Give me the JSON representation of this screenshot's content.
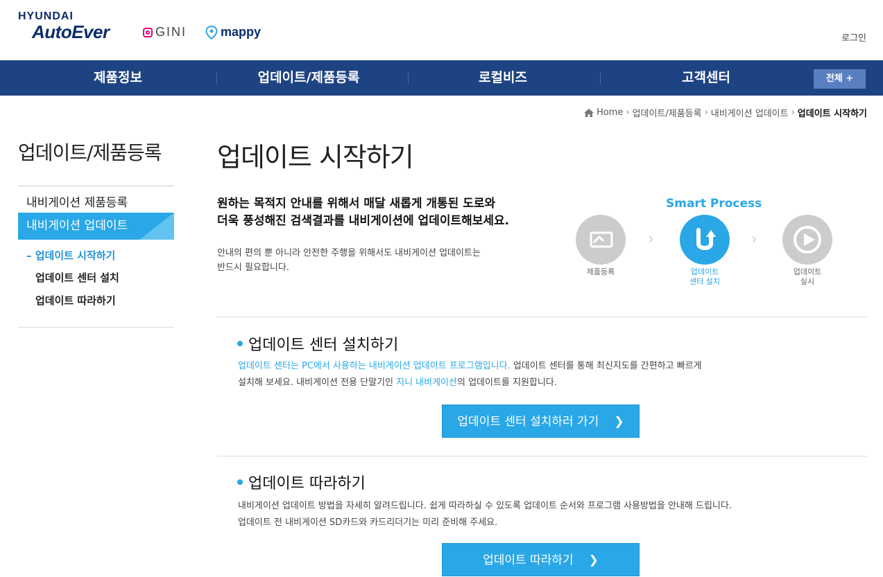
{
  "header": {
    "brand_top": "HYUNDAI",
    "brand_main": "AutoEver",
    "gini": "GINI",
    "mappy": "mappy",
    "login": "로그인"
  },
  "nav": {
    "items": [
      "제품정보",
      "업데이트/제품등록",
      "로컬비즈",
      "고객센터"
    ],
    "all_button": "전체 +"
  },
  "breadcrumb": {
    "home": "Home",
    "level1": "업데이트/제품등록",
    "level2": "내비게이션 업데이트",
    "current": "업데이트 시작하기"
  },
  "sidebar": {
    "title": "업데이트/제품등록",
    "items": [
      "내비게이션 제품등록",
      "내비게이션 업데이트"
    ],
    "subitems": [
      "업데이트 시작하기",
      "업데이트 센터 설치",
      "업데이트 따라하기"
    ]
  },
  "main": {
    "title": "업데이트 시작하기",
    "intro_bold_1": "원하는 목적지 안내를 위해서 매달 새롭게 개통된 도로와",
    "intro_bold_2": "더욱 풍성해진 검색결과를 내비게이션에 업데이트해보세요.",
    "intro_1": "안내의 편의 뿐 아니라 안전한 주행을 위해서도 내비게이션 업데이트는",
    "intro_2": "반드시 필요합니다.",
    "smart_process": {
      "title": "Smart Process",
      "steps": [
        {
          "label_1": "제품등록",
          "label_2": ""
        },
        {
          "label_1": "업데이트",
          "label_2": "센터 설치"
        },
        {
          "label_1": "업데이트",
          "label_2": "실시"
        }
      ]
    },
    "section1": {
      "title": "업데이트 센터 설치하기",
      "line1_highlight": "업데이트 센터는 PC에서 사용하는 내비게이션 업데이트 프로그램입니다.",
      "line1_rest": " 업데이트 센터를 통해 최신지도를 간편하고 빠르게",
      "line2_a": "설치해 보세요. 내비게이션 전용 단말기인 ",
      "line2_highlight": "지니 내비게이션",
      "line2_b": "의 업데이트를 지원합니다.",
      "button": "업데이트 센터 설치하러 가기"
    },
    "section2": {
      "title": "업데이트 따라하기",
      "line1": "내비게이션 업데이트 방법을 자세히 알려드립니다. 쉽게 따라하실 수 있도록 업데이트 순서와 프로그램 사용방법을 안내해 드립니다.",
      "line2": "업데이트 전 내비게이션 SD카드와 카드리더기는 미리 준비해 주세요.",
      "button": "업데이트 따라하기"
    }
  },
  "colors": {
    "nav_bg": "#1e4382",
    "accent": "#2aa7e6",
    "brand": "#0b2d6b"
  }
}
